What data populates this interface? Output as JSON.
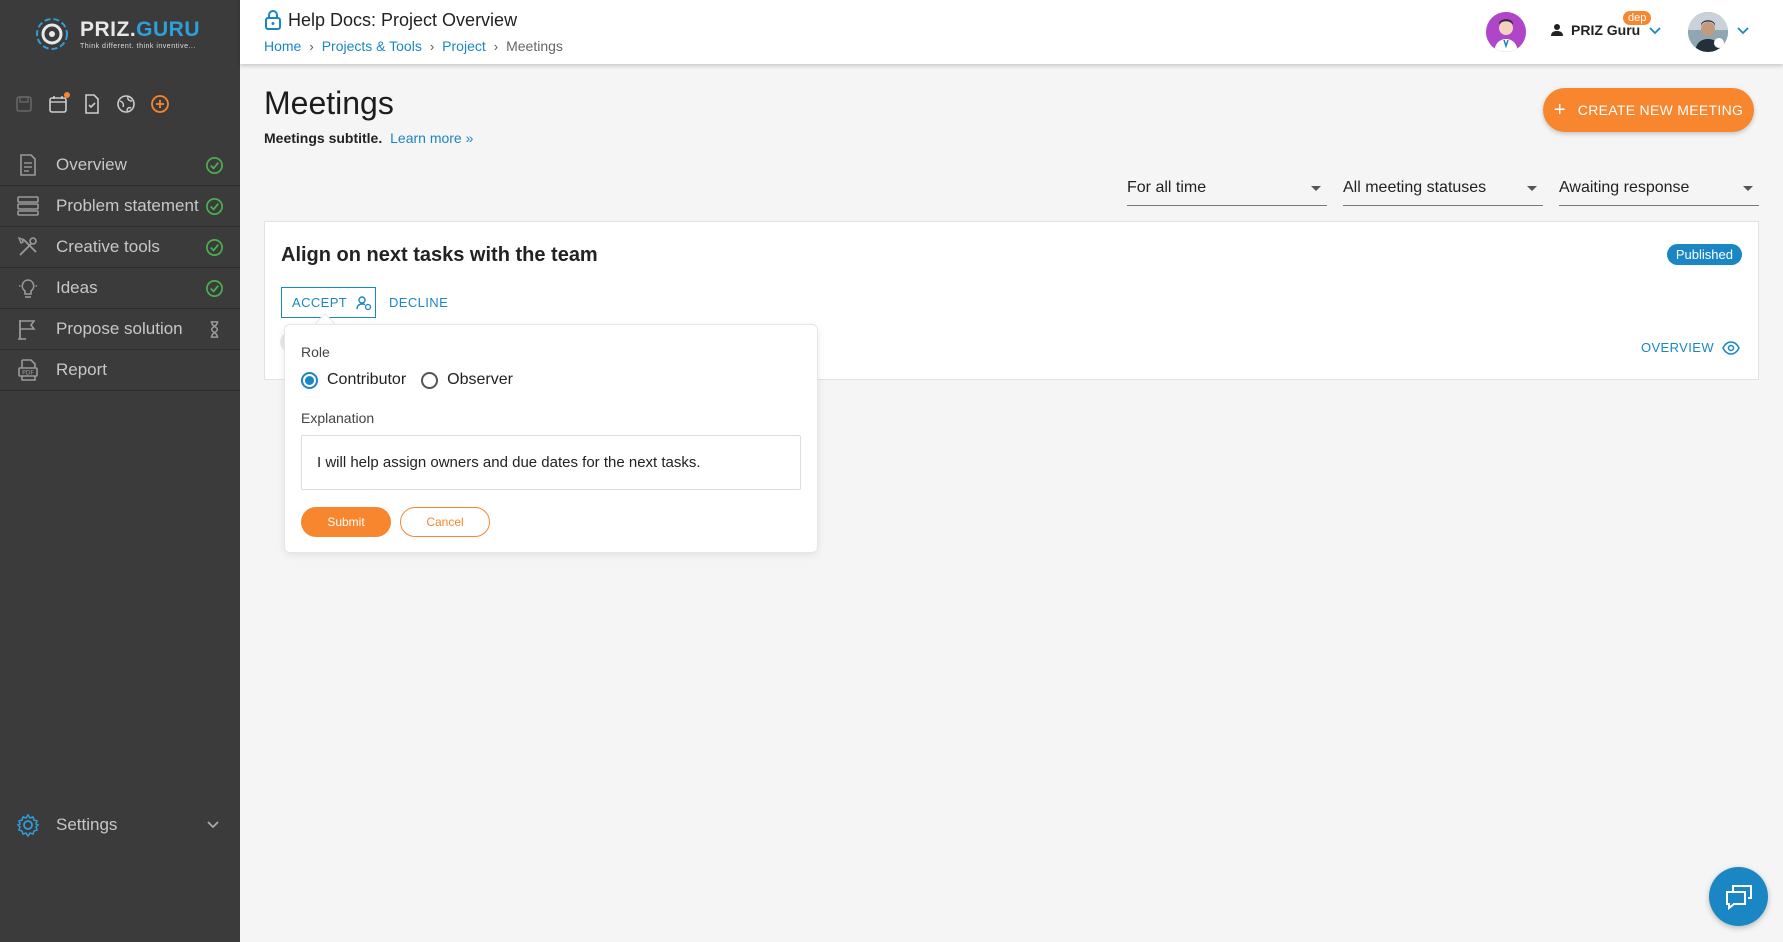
{
  "app": {
    "logo_main": "PRIZ.",
    "logo_accent": "GURU",
    "logo_tagline": "Think different. think inventive..."
  },
  "sidebar": {
    "items": [
      {
        "label": "Overview",
        "icon": "document-icon",
        "status": "check-circle-icon"
      },
      {
        "label": "Problem statement",
        "icon": "stack-icon",
        "status": "check-circle-icon"
      },
      {
        "label": "Creative tools",
        "icon": "tools-icon",
        "status": "check-circle-icon"
      },
      {
        "label": "Ideas",
        "icon": "lightbulb-icon",
        "status": "check-circle-icon"
      },
      {
        "label": "Propose solution",
        "icon": "flag-icon",
        "status": "hourglass-icon"
      },
      {
        "label": "Report",
        "icon": "pdf-icon",
        "status": ""
      }
    ],
    "settings_label": "Settings"
  },
  "header": {
    "title": "Help Docs: Project Overview",
    "breadcrumbs": [
      "Home",
      "Projects & Tools",
      "Project",
      "Meetings"
    ],
    "user_name": "PRIZ Guru",
    "user_badge": "dep"
  },
  "main": {
    "title": "Meetings",
    "subtitle": "Meetings subtitle.",
    "learn_more": "Learn more »",
    "create_button": "CREATE NEW MEETING",
    "filters": {
      "time": "For all time",
      "status": "All meeting statuses",
      "response": "Awaiting response"
    }
  },
  "meeting_card": {
    "title": "Align on next tasks with the team",
    "status_badge": "Published",
    "accept_label": "ACCEPT",
    "decline_label": "DECLINE",
    "overview_label": "OVERVIEW"
  },
  "accept_popover": {
    "role_label": "Role",
    "roles": [
      "Contributor",
      "Observer"
    ],
    "selected_role": "Contributor",
    "explanation_label": "Explanation",
    "explanation_value": "I will help assign owners and due dates for the next tasks.",
    "submit_label": "Submit",
    "cancel_label": "Cancel"
  },
  "colors": {
    "accent_orange": "#f7862e",
    "link_blue": "#1b86c4",
    "sidebar_bg": "#3b3b3b",
    "success_green": "#4caf50"
  }
}
